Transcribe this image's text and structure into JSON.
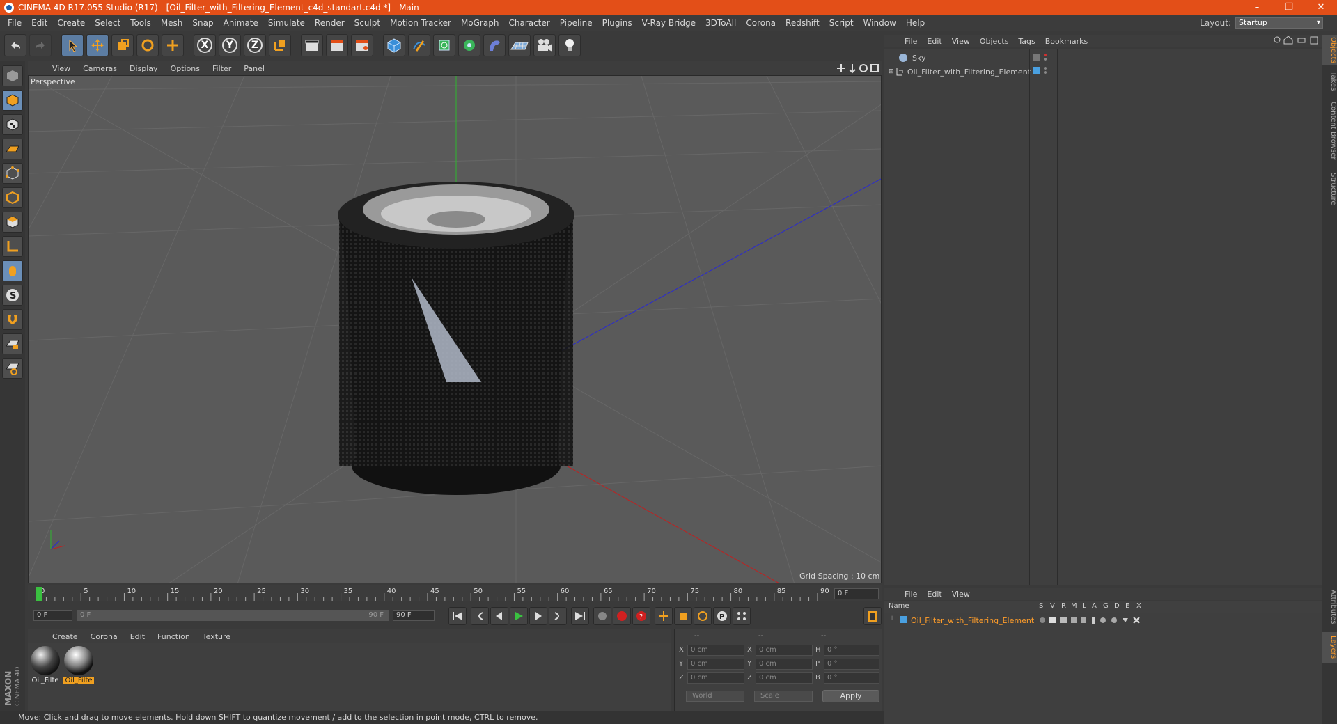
{
  "window": {
    "title": "CINEMA 4D R17.055 Studio (R17) - [Oil_Filter_with_Filtering_Element_c4d_standart.c4d *] - Main",
    "minimize": "–",
    "maximize": "❐",
    "close": "✕"
  },
  "menubar": {
    "items": [
      "File",
      "Edit",
      "Create",
      "Select",
      "Tools",
      "Mesh",
      "Snap",
      "Animate",
      "Simulate",
      "Render",
      "Sculpt",
      "Motion Tracker",
      "MoGraph",
      "Character",
      "Pipeline",
      "Plugins",
      "V-Ray Bridge",
      "3DToAll",
      "Corona",
      "Redshift",
      "Script",
      "Window",
      "Help"
    ],
    "layout_label": "Layout:",
    "layout_value": "Startup"
  },
  "toolbar": {
    "axis_x": "X",
    "axis_y": "Y",
    "axis_z": "Z"
  },
  "viewport": {
    "menu": [
      "View",
      "Cameras",
      "Display",
      "Options",
      "Filter",
      "Panel"
    ],
    "label": "Perspective",
    "grid_spacing": "Grid Spacing : 10 cm"
  },
  "timeline": {
    "ticks": [
      "0",
      "5",
      "10",
      "15",
      "20",
      "25",
      "30",
      "35",
      "40",
      "45",
      "50",
      "55",
      "60",
      "65",
      "70",
      "75",
      "80",
      "85",
      "90"
    ],
    "current_frame": "0 F",
    "start_frame": "0 F",
    "range_start": "0 F",
    "range_end": "90 F",
    "end_frame": "90 F"
  },
  "materials": {
    "menu": [
      "Create",
      "Corona",
      "Edit",
      "Function",
      "Texture"
    ],
    "items": [
      {
        "name": "Oil_Filte"
      },
      {
        "name": "Oil_Filte"
      }
    ]
  },
  "coordinates": {
    "header": [
      "--",
      "--",
      "--"
    ],
    "rows": [
      {
        "axis": "X",
        "pos": "0 cm",
        "axis2": "X",
        "size": "0 cm",
        "rot_label": "H",
        "rot": "0 °"
      },
      {
        "axis": "Y",
        "pos": "0 cm",
        "axis2": "Y",
        "size": "0 cm",
        "rot_label": "P",
        "rot": "0 °"
      },
      {
        "axis": "Z",
        "pos": "0 cm",
        "axis2": "Z",
        "size": "0 cm",
        "rot_label": "B",
        "rot": "0 °"
      }
    ],
    "mode": "World",
    "scale_mode": "Scale",
    "apply": "Apply"
  },
  "status": "Move: Click and drag to move elements. Hold down SHIFT to quantize movement / add to the selection in point mode, CTRL to remove.",
  "object_manager": {
    "menu": [
      "File",
      "Edit",
      "View",
      "Objects",
      "Tags",
      "Bookmarks"
    ],
    "objects": [
      {
        "name": "Sky"
      },
      {
        "name": "Oil_Filter_with_Filtering_Element"
      }
    ]
  },
  "layer_manager": {
    "menu": [
      "File",
      "Edit",
      "View"
    ],
    "columns": [
      "Name",
      "S",
      "V",
      "R",
      "M",
      "L",
      "A",
      "G",
      "D",
      "E",
      "X"
    ],
    "layers": [
      {
        "name": "Oil_Filter_with_Filtering_Element"
      }
    ]
  },
  "side_tabs": [
    "Objects",
    "Takes",
    "Content Browser",
    "Structure",
    "Attributes",
    "Layers"
  ],
  "brand": "MAXON CINEMA 4D",
  "colors": {
    "accent": "#e34f18",
    "selection": "#ff9d2a",
    "highlight": "#5c7da3"
  }
}
